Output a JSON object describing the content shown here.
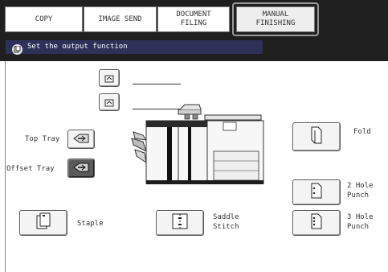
{
  "tabs": [
    {
      "label": "COPY",
      "active": false
    },
    {
      "label": "IMAGE SEND",
      "active": false
    },
    {
      "label_lines": [
        "DOCUMENT",
        "FILING"
      ],
      "active": false
    },
    {
      "label_lines": [
        "MANUAL",
        "FINISHING"
      ],
      "active": true
    }
  ],
  "message": "Set the output function",
  "left": {
    "top_tray": "Top Tray",
    "offset_tray": "Offset Tray",
    "staple": "Staple"
  },
  "center": {
    "saddle_stitch_lines": [
      "Saddle",
      "Stitch"
    ]
  },
  "right": {
    "fold": "Fold",
    "punch2_lines": [
      "2 Hole",
      "Punch"
    ],
    "punch3_lines": [
      "3 Hole",
      "Punch"
    ]
  },
  "colors": {
    "dark_bar": "#1f1f1f",
    "message_strip": "#2d3158",
    "selected_button": "#5a5a5a"
  },
  "icons": [
    "info-icon",
    "tray-up-icon",
    "tray-arrow-icon",
    "staple-icon",
    "saddle-stitch-icon",
    "fold-icon",
    "punch-2-icon",
    "punch-3-icon"
  ]
}
